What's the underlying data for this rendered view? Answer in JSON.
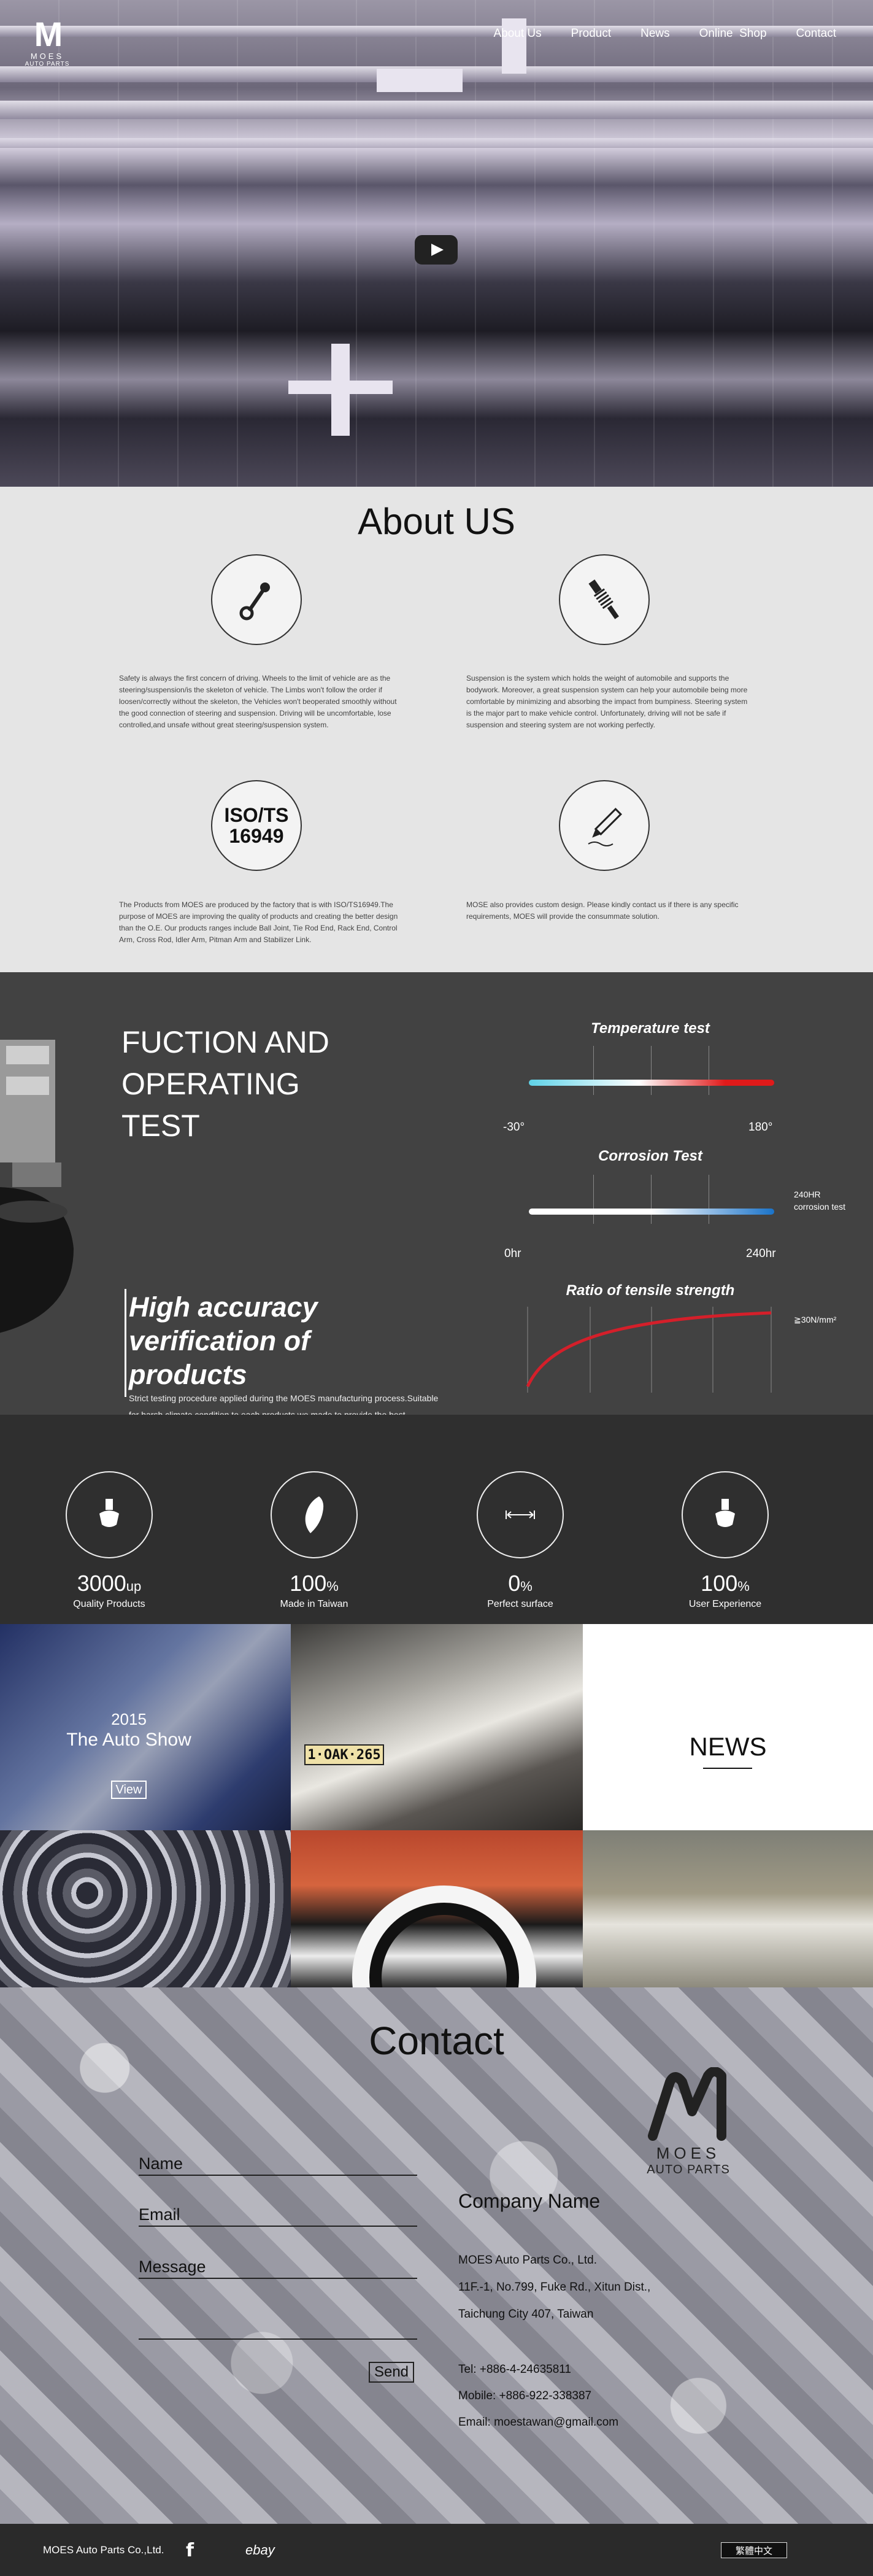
{
  "nav": {
    "items": [
      "About Us",
      "Product",
      "News",
      "Online  Shop",
      "Contact"
    ]
  },
  "brand": {
    "name": "MOES",
    "sub": "AUTO PARTS"
  },
  "about": {
    "title": "About US",
    "blocks": [
      {
        "icon": "steering-rod-icon",
        "text": "Safety is always the first concern of driving.\nWheels to the limit of vehicle are as the steering/suspension/is the skeleton of vehicle. The Limbs won't follow the order if loosen/correctly without the skeleton, the Vehicles won't beoperated smoothly without the good connection of steering and suspension. Driving will be uncomfortable, lose controlled,and unsafe without great steering/suspension system."
      },
      {
        "icon": "shock-absorber-icon",
        "text": "Suspension is the system which holds the weight of automobile and supports the bodywork. Moreover, a great suspension system can help your automobile being more comfortable by minimizing and absorbing the impact from bumpiness. Steering system is the major part to make vehicle control. Unfortunately, driving will not be safe if suspension and steering system are not working perfectly."
      },
      {
        "icon": "iso-certificate-icon",
        "iso_line1": "ISO/TS",
        "iso_line2": "16949",
        "text": "The Products from MOES are produced by the factory that is with ISO/TS16949.The purpose of MOES are improving the quality of products and creating the better design than the O.E. Our products ranges include Ball Joint, Tie Rod End, Rack End, Control Arm, Cross Rod, Idler Arm, Pitman Arm and Stabilizer Link."
      },
      {
        "icon": "pen-design-icon",
        "text": "MOSE also provides custom design. Please kindly contact us if there is any specific requirements, MOES will provide the consummate solution."
      }
    ]
  },
  "test": {
    "title_lines": [
      "FUCTION AND",
      "OPERATING",
      "TEST"
    ],
    "headline_lines": [
      "High accuracy",
      "verification of",
      "products"
    ],
    "description": "Strict testing procedure applied during the MOES manufacturing process.Suitable for harsh climate condition to each products we made to provide the best experience to the users",
    "temperature": {
      "title": "Temperature test",
      "min": "-30°",
      "max": "180°",
      "colors": [
        "#5fd3e8",
        "#ffffff",
        "#e01a1a"
      ]
    },
    "corrosion": {
      "title": "Corrosion Test",
      "min": "0hr",
      "max": "240hr",
      "note_line1": "240HR",
      "note_line2": "corrosion test",
      "colors": [
        "#ffffff",
        "#1a73c9"
      ]
    },
    "tensile": {
      "title": "Ratio of tensile strength",
      "note": "≧30N/mm²",
      "color": "#d41f2a"
    }
  },
  "stats": [
    {
      "icon": "ball-joint-icon",
      "value": "3000",
      "unit": "up",
      "label": "Quality Products"
    },
    {
      "icon": "taiwan-map-icon",
      "value": "100",
      "unit": "%",
      "label": "Made in Taiwan"
    },
    {
      "icon": "arrows-width-icon",
      "value": "0",
      "unit": "%",
      "label": "Perfect surface"
    },
    {
      "icon": "ball-joint-icon",
      "value": "100",
      "unit": "%",
      "label": "User Experience"
    }
  ],
  "news": {
    "title": "NEWS",
    "featured": {
      "year": "2015",
      "headline": "The Auto Show",
      "button": "View"
    }
  },
  "contact": {
    "title": "Contact",
    "fields": {
      "name": "Name",
      "email": "Email",
      "message": "Message"
    },
    "send": "Send",
    "company": "Company Name",
    "lines": [
      "MOES Auto Parts Co., Ltd.",
      "11F.-1, No.799, Fuke Rd., Xitun Dist.,",
      "Taichung City 407, Taiwan",
      "Tel: +886-4-24635811",
      "Mobile: +886-922-338387",
      "Email: moestawan@gmail.com"
    ],
    "logo_line1": "MOES",
    "logo_line2": "AUTO PARTS"
  },
  "footer": {
    "copyright": "MOES Auto Parts Co.,Ltd.",
    "facebook": "f",
    "ebay": "ebay",
    "language": "繁體中文"
  }
}
